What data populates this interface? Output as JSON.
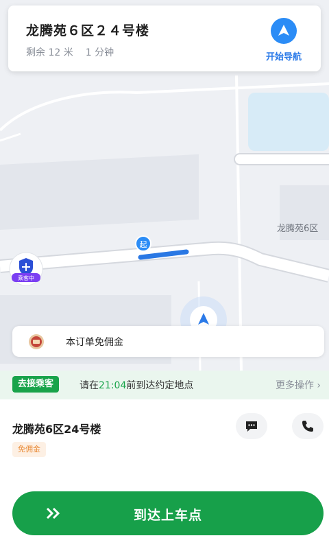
{
  "nav_card": {
    "title": "龙腾苑６区２４号楼",
    "remaining_distance": "剩余 12 米",
    "remaining_time": "1 分钟",
    "start_nav_label": "开始导航"
  },
  "map": {
    "place_label": "龙腾苑6区",
    "start_marker": "起",
    "passenger_badge": "乘客中"
  },
  "fee_bar": {
    "text": "本订单免佣金"
  },
  "status": {
    "tag": "去接乘客",
    "prefix": "请在",
    "time": "21:04",
    "suffix": "前到达约定地点",
    "more_ops": "更多操作 ›"
  },
  "destination": {
    "name": "龙腾苑6区24号楼",
    "chip": "免佣金"
  },
  "action": {
    "arrive_label": "到达上车点"
  },
  "colors": {
    "primary_green": "#17a04a",
    "nav_blue": "#2b8cf6"
  }
}
